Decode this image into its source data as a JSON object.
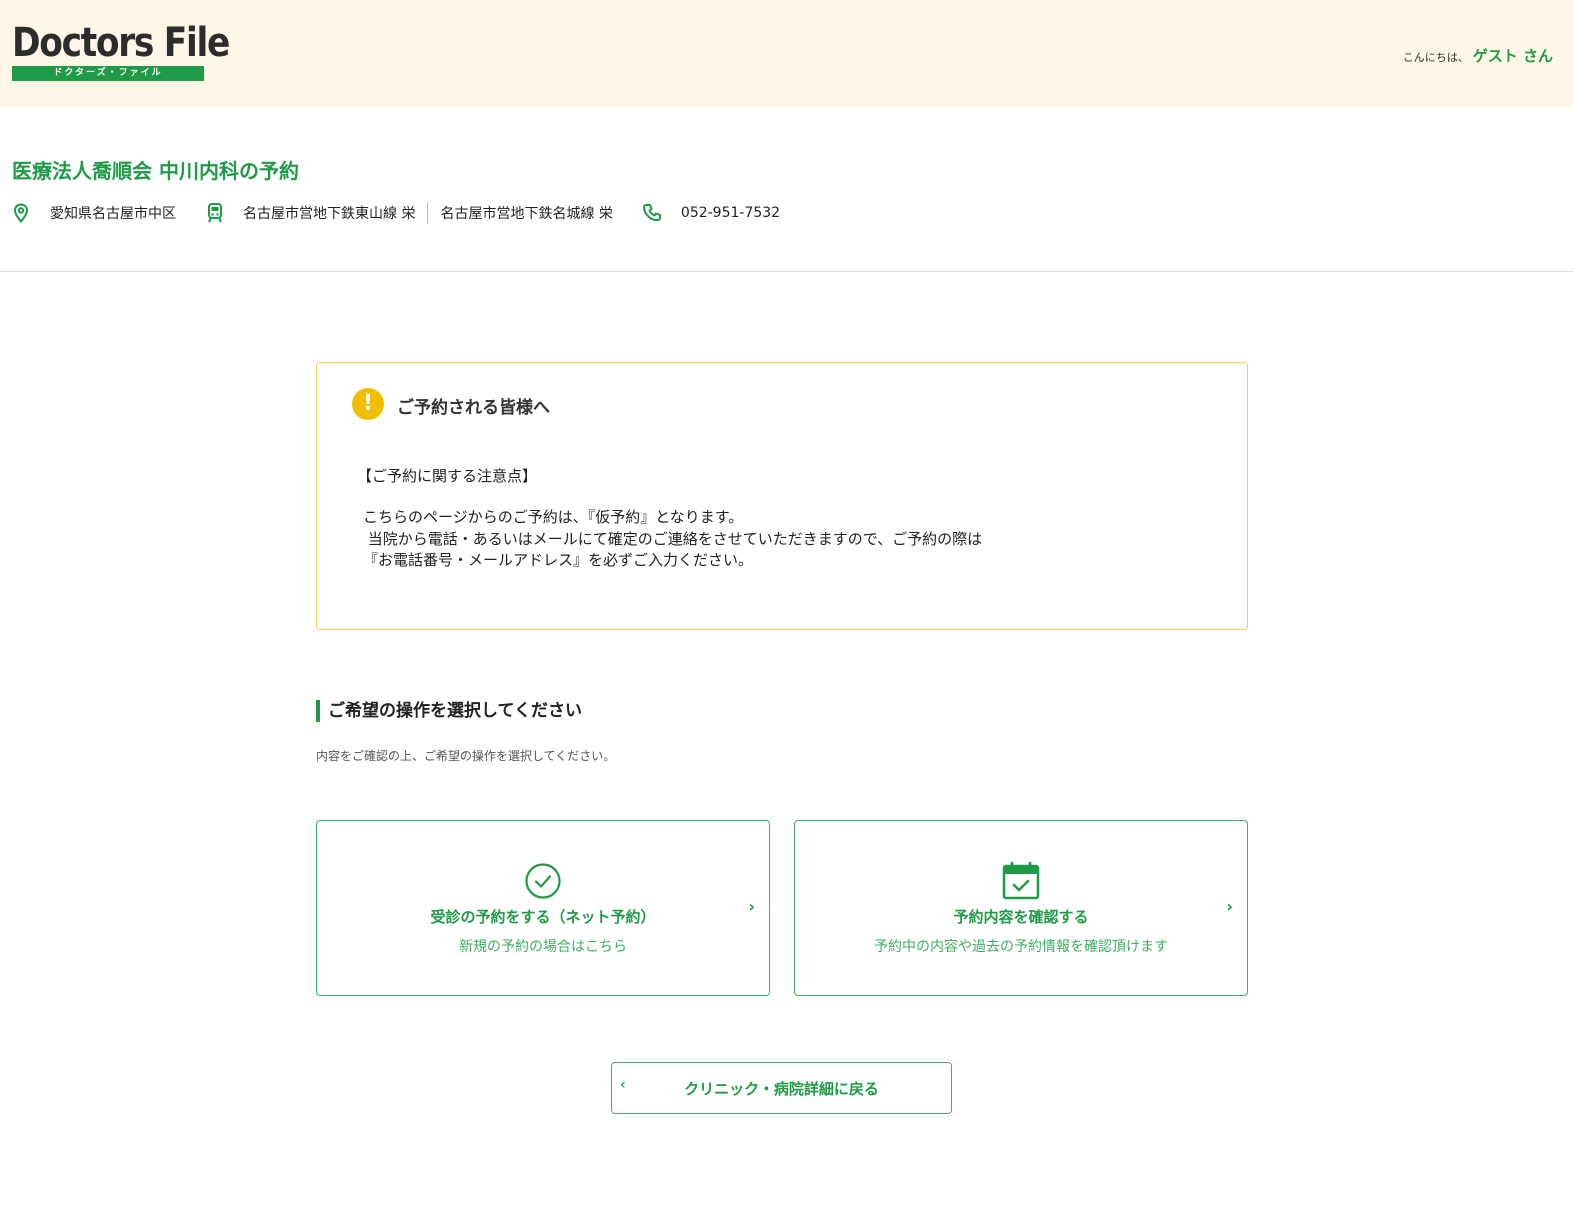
{
  "header": {
    "logo_text": "Doctors File",
    "logo_sub": "ドクターズ・ファイル",
    "greeting": "こんにちは、",
    "user_name": "ゲスト さん"
  },
  "clinic": {
    "title": "医療法人喬順会 中川内科の予約",
    "address": "愛知県名古屋市中区",
    "station_1": "名古屋市営地下鉄東山線 栄",
    "station_2": "名古屋市営地下鉄名城線 栄",
    "phone": "052-951-7532"
  },
  "notice": {
    "title": "ご予約される皆様へ",
    "subtitle": "【ご予約に関する注意点】",
    "body": "こちらのページからのご予約は、『仮予約』となります。\n 当院から電話・あるいはメールにて確定のご連絡をさせていただきますので、ご予約の際は\n『お電話番号・メールアドレス』を必ずご入力ください。"
  },
  "section": {
    "title": "ご希望の操作を選択してください",
    "description": "内容をご確認の上、ご希望の操作を選択してください。"
  },
  "cards": [
    {
      "label": "受診の予約をする（ネット予約）",
      "sub": "新規の予約の場合はこちら",
      "icon": "check-circle-icon"
    },
    {
      "label": "予約内容を確認する",
      "sub": "予約中の内容や過去の予約情報を確認頂けます",
      "icon": "calendar-check-icon"
    }
  ],
  "back_button": {
    "label": "クリニック・病院詳細に戻る"
  },
  "colors": {
    "brand_green": "#1f9a47",
    "header_bg": "#fef6e6",
    "warning_yellow": "#f0c000",
    "notice_border": "#f0d050"
  }
}
